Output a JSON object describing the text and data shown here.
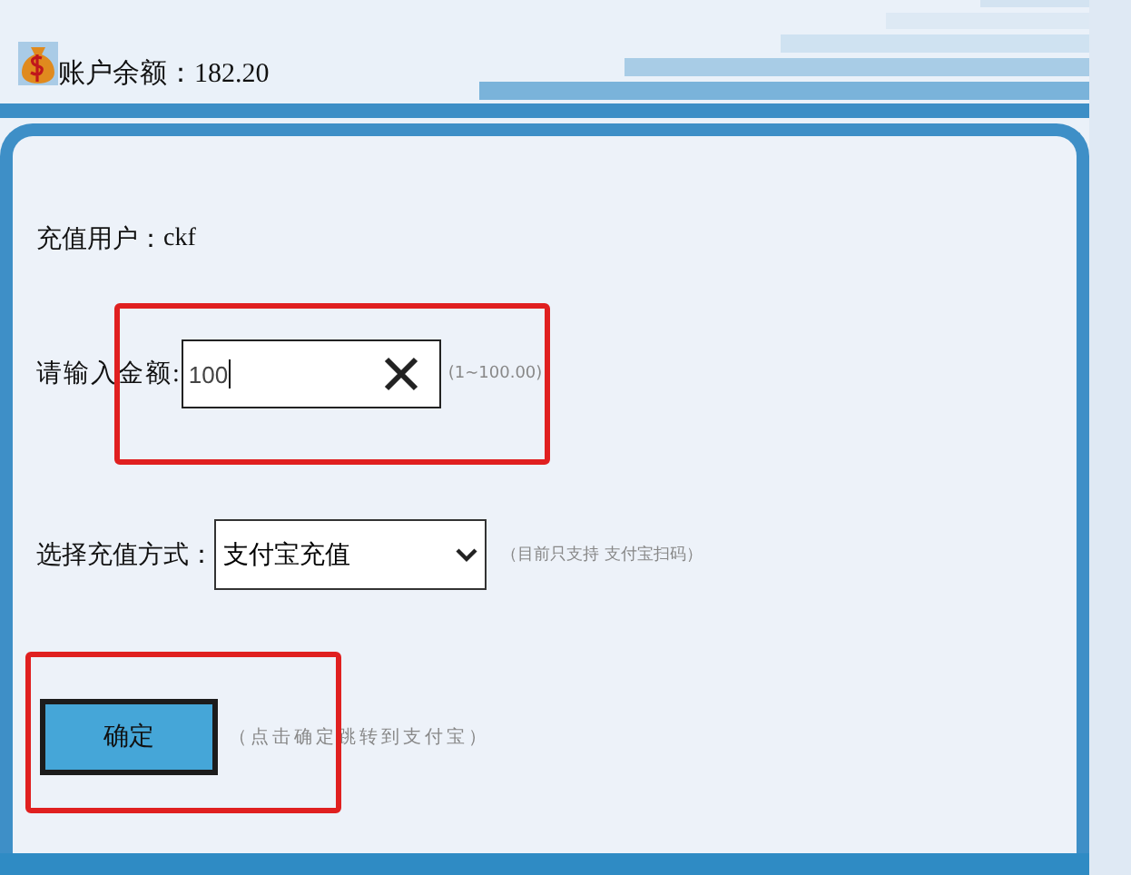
{
  "header": {
    "balance_label": "账户余额：",
    "balance": "182.20"
  },
  "form": {
    "user_label": "充值用户：",
    "user": "ckf",
    "amount_label": "请输入金额:",
    "amount_value": "100",
    "amount_hint": "(1~100.00)",
    "method_label": "选择充值方式：",
    "method_value": "支付宝充值",
    "method_hint": "（目前只支持 支付宝扫码）",
    "submit": "确定",
    "submit_hint": "（点击确定跳转到支付宝）"
  }
}
